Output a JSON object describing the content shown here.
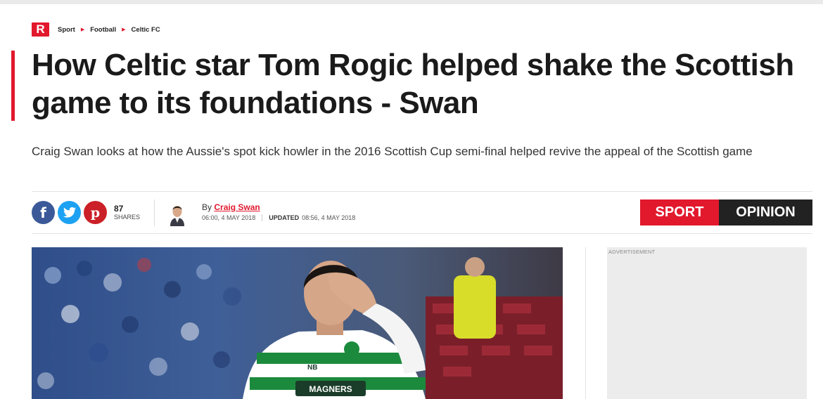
{
  "brand": {
    "logo_letter": "R",
    "accent": "#e2182d"
  },
  "breadcrumb": [
    "Sport",
    "Football",
    "Celtic FC"
  ],
  "article": {
    "title": "How Celtic star Tom Rogic helped shake the Scottish game to its foundations - Swan",
    "standfirst": "Craig Swan looks at how the Aussie's spot kick howler in the 2016 Scottish Cup semi-final helped revive the appeal of the Scottish game",
    "byline_prefix": "By",
    "author": "Craig Swan",
    "published": "06:00, 4 MAY 2018",
    "updated_label": "UPDATED",
    "updated": "08:56, 4 MAY 2018"
  },
  "share": {
    "count": "87",
    "label": "SHARES",
    "buttons": [
      {
        "name": "facebook",
        "icon": "facebook-icon",
        "glyph": "f",
        "color": "#3b5998"
      },
      {
        "name": "twitter",
        "icon": "twitter-icon",
        "glyph": "",
        "color": "#1da1f2"
      },
      {
        "name": "pinterest",
        "icon": "pinterest-icon",
        "glyph": "p",
        "color": "#cb2027"
      }
    ]
  },
  "tags": {
    "primary": "SPORT",
    "secondary": "OPINION"
  },
  "hero": {
    "shirt_sponsor": "MAGNERS",
    "kit_logo": "NB"
  },
  "ad": {
    "label": "ADVERTISEMENT"
  }
}
